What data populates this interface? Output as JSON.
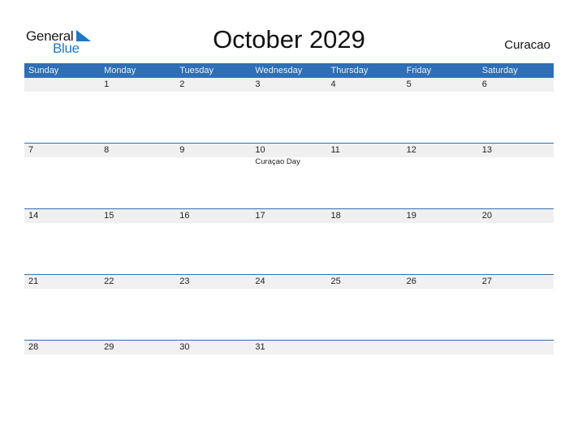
{
  "logo": {
    "line1": "General",
    "line2": "Blue"
  },
  "title": "October 2029",
  "country": "Curacao",
  "colors": {
    "accent": "#2e6fb5",
    "date_strip": "#f0f0f0",
    "logo_blue": "#1f78c8"
  },
  "weekdays": [
    "Sunday",
    "Monday",
    "Tuesday",
    "Wednesday",
    "Thursday",
    "Friday",
    "Saturday"
  ],
  "weeks": [
    {
      "days": [
        {
          "num": "",
          "event": ""
        },
        {
          "num": "1",
          "event": ""
        },
        {
          "num": "2",
          "event": ""
        },
        {
          "num": "3",
          "event": ""
        },
        {
          "num": "4",
          "event": ""
        },
        {
          "num": "5",
          "event": ""
        },
        {
          "num": "6",
          "event": ""
        }
      ]
    },
    {
      "days": [
        {
          "num": "7",
          "event": ""
        },
        {
          "num": "8",
          "event": ""
        },
        {
          "num": "9",
          "event": ""
        },
        {
          "num": "10",
          "event": "Curaçao Day"
        },
        {
          "num": "11",
          "event": ""
        },
        {
          "num": "12",
          "event": ""
        },
        {
          "num": "13",
          "event": ""
        }
      ]
    },
    {
      "days": [
        {
          "num": "14",
          "event": ""
        },
        {
          "num": "15",
          "event": ""
        },
        {
          "num": "16",
          "event": ""
        },
        {
          "num": "17",
          "event": ""
        },
        {
          "num": "18",
          "event": ""
        },
        {
          "num": "19",
          "event": ""
        },
        {
          "num": "20",
          "event": ""
        }
      ]
    },
    {
      "days": [
        {
          "num": "21",
          "event": ""
        },
        {
          "num": "22",
          "event": ""
        },
        {
          "num": "23",
          "event": ""
        },
        {
          "num": "24",
          "event": ""
        },
        {
          "num": "25",
          "event": ""
        },
        {
          "num": "26",
          "event": ""
        },
        {
          "num": "27",
          "event": ""
        }
      ]
    },
    {
      "days": [
        {
          "num": "28",
          "event": ""
        },
        {
          "num": "29",
          "event": ""
        },
        {
          "num": "30",
          "event": ""
        },
        {
          "num": "31",
          "event": ""
        },
        {
          "num": "",
          "event": ""
        },
        {
          "num": "",
          "event": ""
        },
        {
          "num": "",
          "event": ""
        }
      ]
    }
  ]
}
